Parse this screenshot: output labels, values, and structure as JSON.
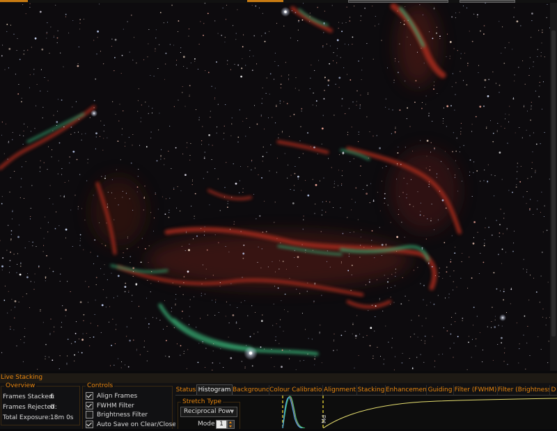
{
  "panel": {
    "title": "Live Stacking"
  },
  "overview": {
    "legend": "Overview",
    "frames_stacked_label": "Frames Stacked:",
    "frames_stacked_value": "6",
    "frames_rejected_label": "Frames Rejected:",
    "frames_rejected_value": "0",
    "total_exposure_label": "Total Exposure:",
    "total_exposure_value": "18m 0s"
  },
  "controls": {
    "legend": "Controls",
    "items": [
      {
        "label": "Align Frames",
        "checked": true
      },
      {
        "label": "FWHM Filter",
        "checked": true
      },
      {
        "label": "Brightness Filter",
        "checked": false
      },
      {
        "label": "Auto Save on Clear/Close",
        "checked": true
      }
    ]
  },
  "tabs": [
    "Status",
    "Histogram",
    "Background",
    "Colour Calibration",
    "Alignment",
    "Stacking",
    "Enhancement",
    "Guiding",
    "Filter (FWHM)",
    "Filter (Brightness)",
    "D"
  ],
  "active_tab": "Histogram",
  "histogram": {
    "stretch_legend": "Stretch Type",
    "stretch_value": "Reciprocal Pow",
    "mode_label": "Mode",
    "mode_value": "1",
    "marker_label": "Md"
  },
  "colors": {
    "accent": "#e8860e",
    "panel_bg": "#111113",
    "text": "#dcdcdc",
    "nebula_red": "#b0301e",
    "nebula_green": "#3aa070"
  }
}
